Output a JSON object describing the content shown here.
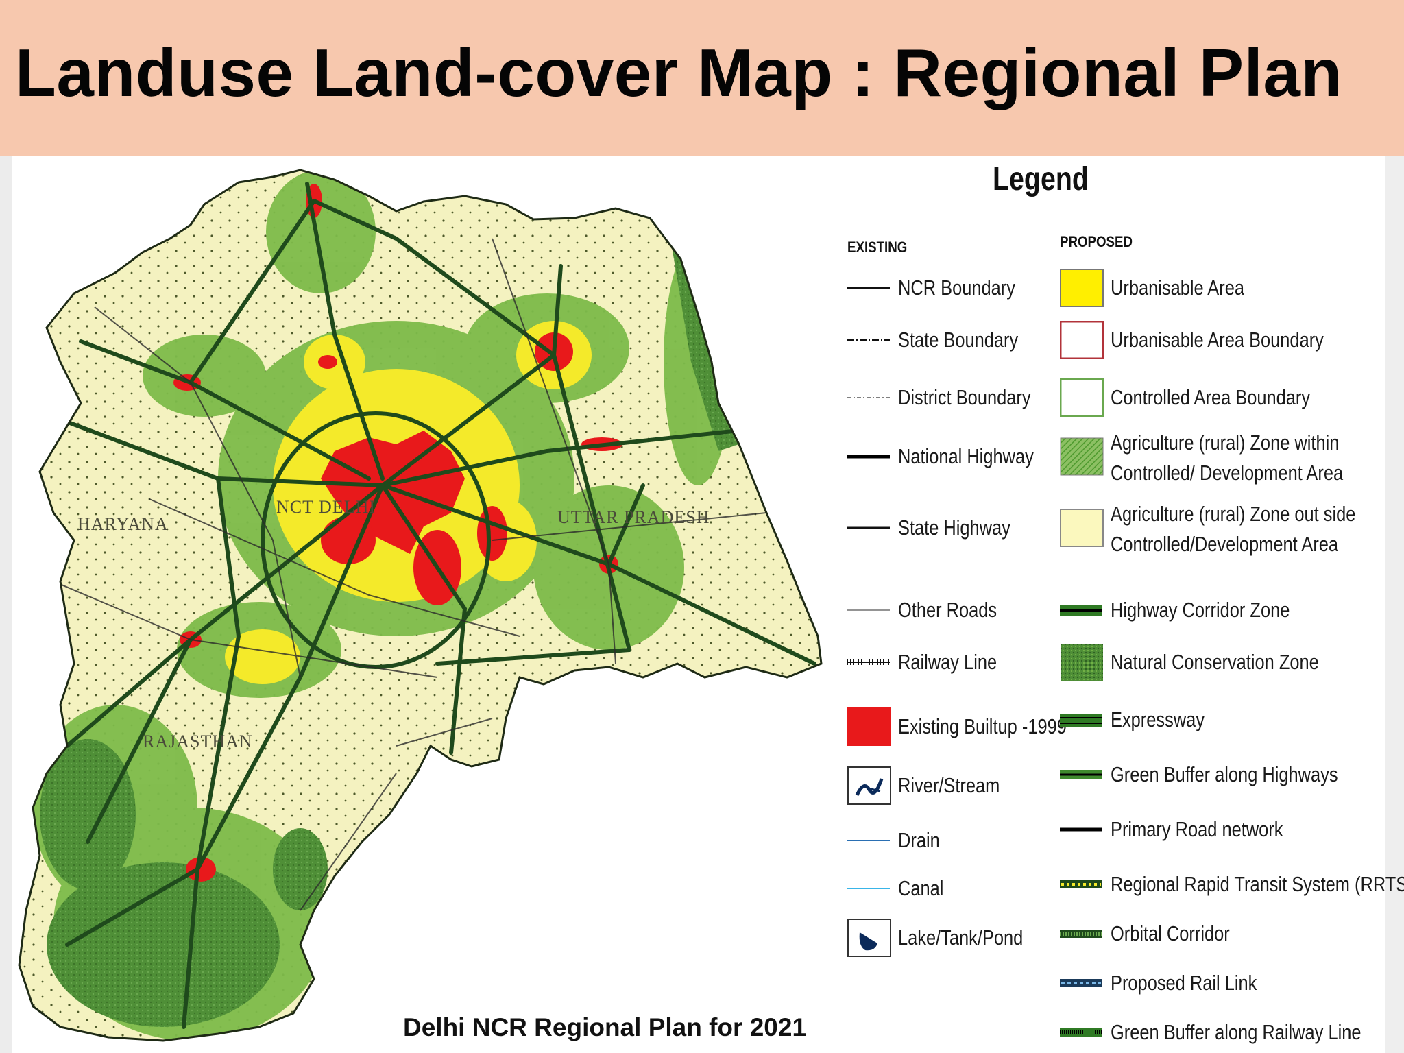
{
  "title": "Landuse Land-cover Map : Regional Plan",
  "caption": "Delhi NCR Regional Plan for 2021",
  "map": {
    "region_labels": [
      "HARYANA",
      "NCT DELHI",
      "UTTAR PRADESH",
      "RAJASTHAN"
    ],
    "colors": {
      "agriculture_outside": "#f4f2c0",
      "agriculture_controlled": "#7dbb4a",
      "conservation": "#4f8f37",
      "urbanisable": "#f4ea2a",
      "builtup": "#e8191b",
      "highway": "#1f4a1c"
    }
  },
  "legend": {
    "title": "Legend",
    "existing_heading": "EXISTING",
    "proposed_heading": "PROPOSED",
    "existing": [
      {
        "label": "NCR Boundary",
        "icon": "ncr-boundary-line"
      },
      {
        "label": "State Boundary",
        "icon": "state-boundary-line"
      },
      {
        "label": "District Boundary",
        "icon": "district-boundary-line"
      },
      {
        "label": "National Highway",
        "icon": "national-highway-line"
      },
      {
        "label": "State Highway",
        "icon": "state-highway-line"
      },
      {
        "label": "Other Roads",
        "icon": "other-roads-line"
      },
      {
        "label": "Railway Line",
        "icon": "railway-line"
      },
      {
        "label": "Existing Builtup -1999",
        "icon": "builtup-swatch",
        "color": "#e8191b"
      },
      {
        "label": "River/Stream",
        "icon": "river-icon"
      },
      {
        "label": "Drain",
        "icon": "drain-line",
        "color": "#2a6fb3"
      },
      {
        "label": "Canal",
        "icon": "canal-line",
        "color": "#39b5e8"
      },
      {
        "label": "Lake/Tank/Pond",
        "icon": "lake-icon"
      }
    ],
    "proposed": [
      {
        "label": "Urbanisable Area",
        "icon": "urbanisable-swatch",
        "color": "#ffef00"
      },
      {
        "label": "Urbanisable Area Boundary",
        "icon": "urbanisable-boundary-swatch",
        "color": "#b2333a"
      },
      {
        "label": "Controlled Area Boundary",
        "icon": "controlled-boundary-swatch",
        "color": "#6aa84f"
      },
      {
        "label": "Agriculture (rural) Zone within",
        "label2": "Controlled/ Development Area",
        "icon": "agri-controlled-swatch",
        "color": "#5fa83a"
      },
      {
        "label": "Agriculture (rural) Zone out side",
        "label2": "Controlled/Development Area",
        "icon": "agri-outside-swatch",
        "color": "#fbf8be"
      },
      {
        "label": "Highway Corridor Zone",
        "icon": "highway-corridor-line"
      },
      {
        "label": "Natural Conservation Zone",
        "icon": "conservation-swatch",
        "color": "#4f8f37"
      },
      {
        "label": "Expressway",
        "icon": "expressway-line"
      },
      {
        "label": "Green Buffer along Highways",
        "icon": "green-buffer-line"
      },
      {
        "label": "Primary Road network",
        "icon": "primary-road-line"
      },
      {
        "label": "Regional Rapid Transit System (RRTS)",
        "icon": "rrts-line"
      },
      {
        "label": "Orbital Corridor",
        "icon": "orbital-line"
      },
      {
        "label": "Proposed Rail Link",
        "icon": "rail-link-line"
      },
      {
        "label": "Green Buffer along Railway Line",
        "icon": "rail-buffer-line"
      }
    ]
  }
}
